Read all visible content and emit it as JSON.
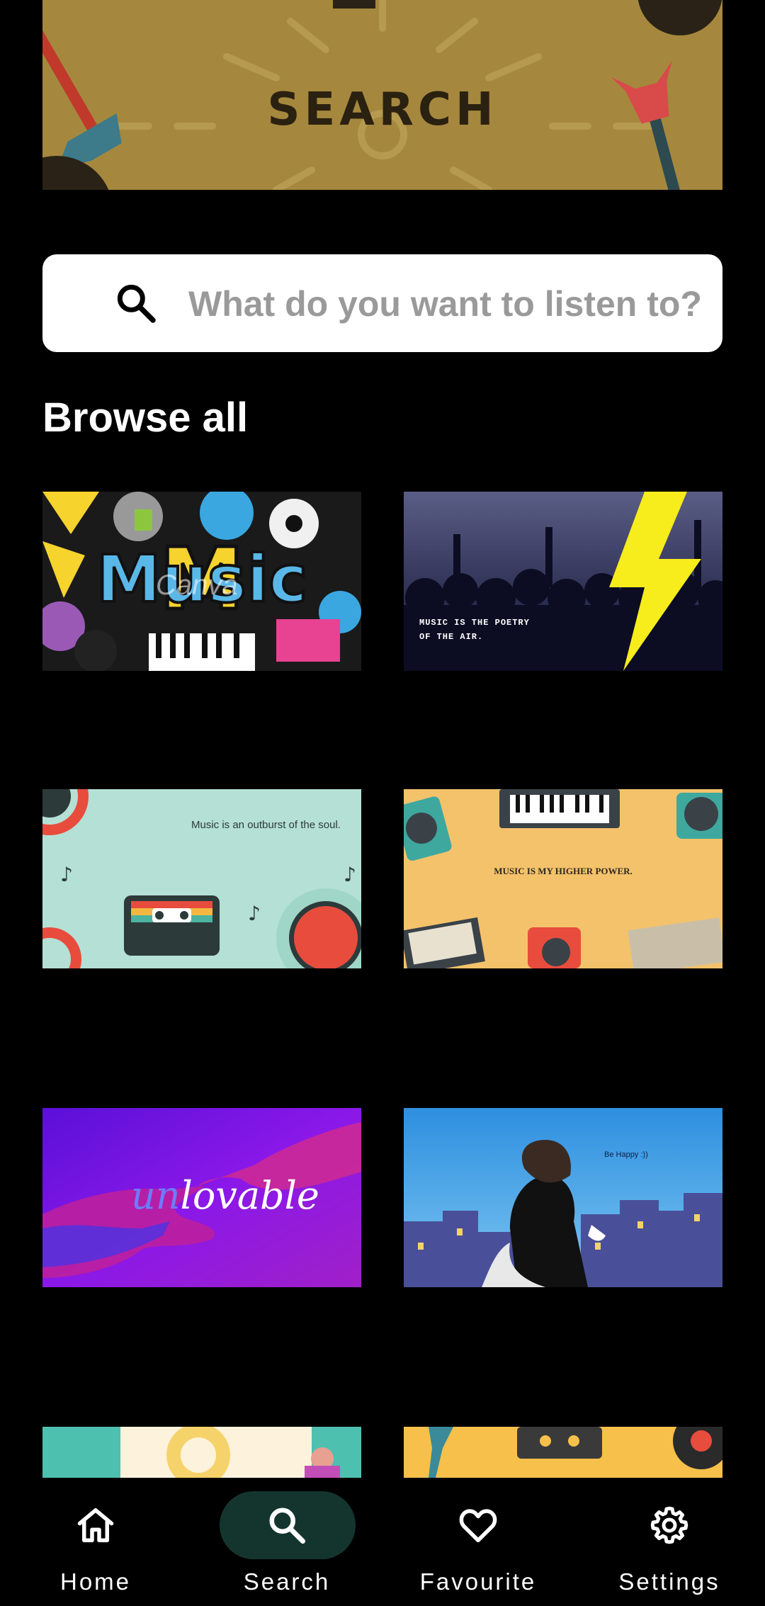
{
  "banner": {
    "title": "SEARCH"
  },
  "search": {
    "placeholder": "What do you want to listen to?",
    "value": ""
  },
  "browse": {
    "title": "Browse all"
  },
  "cards": [
    {
      "label": "Music",
      "watermark": "Canva"
    },
    {
      "caption_line1": "MUSIC IS THE POETRY",
      "caption_line2": "OF THE AIR."
    },
    {
      "caption": "Music is an outburst of the soul."
    },
    {
      "caption": "MUSIC IS MY HIGHER POWER."
    },
    {
      "caption_prefix": "un",
      "caption_main": "lovable"
    },
    {
      "caption": "Be Happy :))"
    }
  ],
  "nav": {
    "items": [
      {
        "label": "Home",
        "icon": "home-icon"
      },
      {
        "label": "Search",
        "icon": "search-icon",
        "active": true
      },
      {
        "label": "Favourite",
        "icon": "heart-icon"
      },
      {
        "label": "Settings",
        "icon": "gear-icon"
      }
    ]
  },
  "colors": {
    "background": "#000000",
    "active_pill": "#14352e",
    "banner": "#a5883e"
  }
}
